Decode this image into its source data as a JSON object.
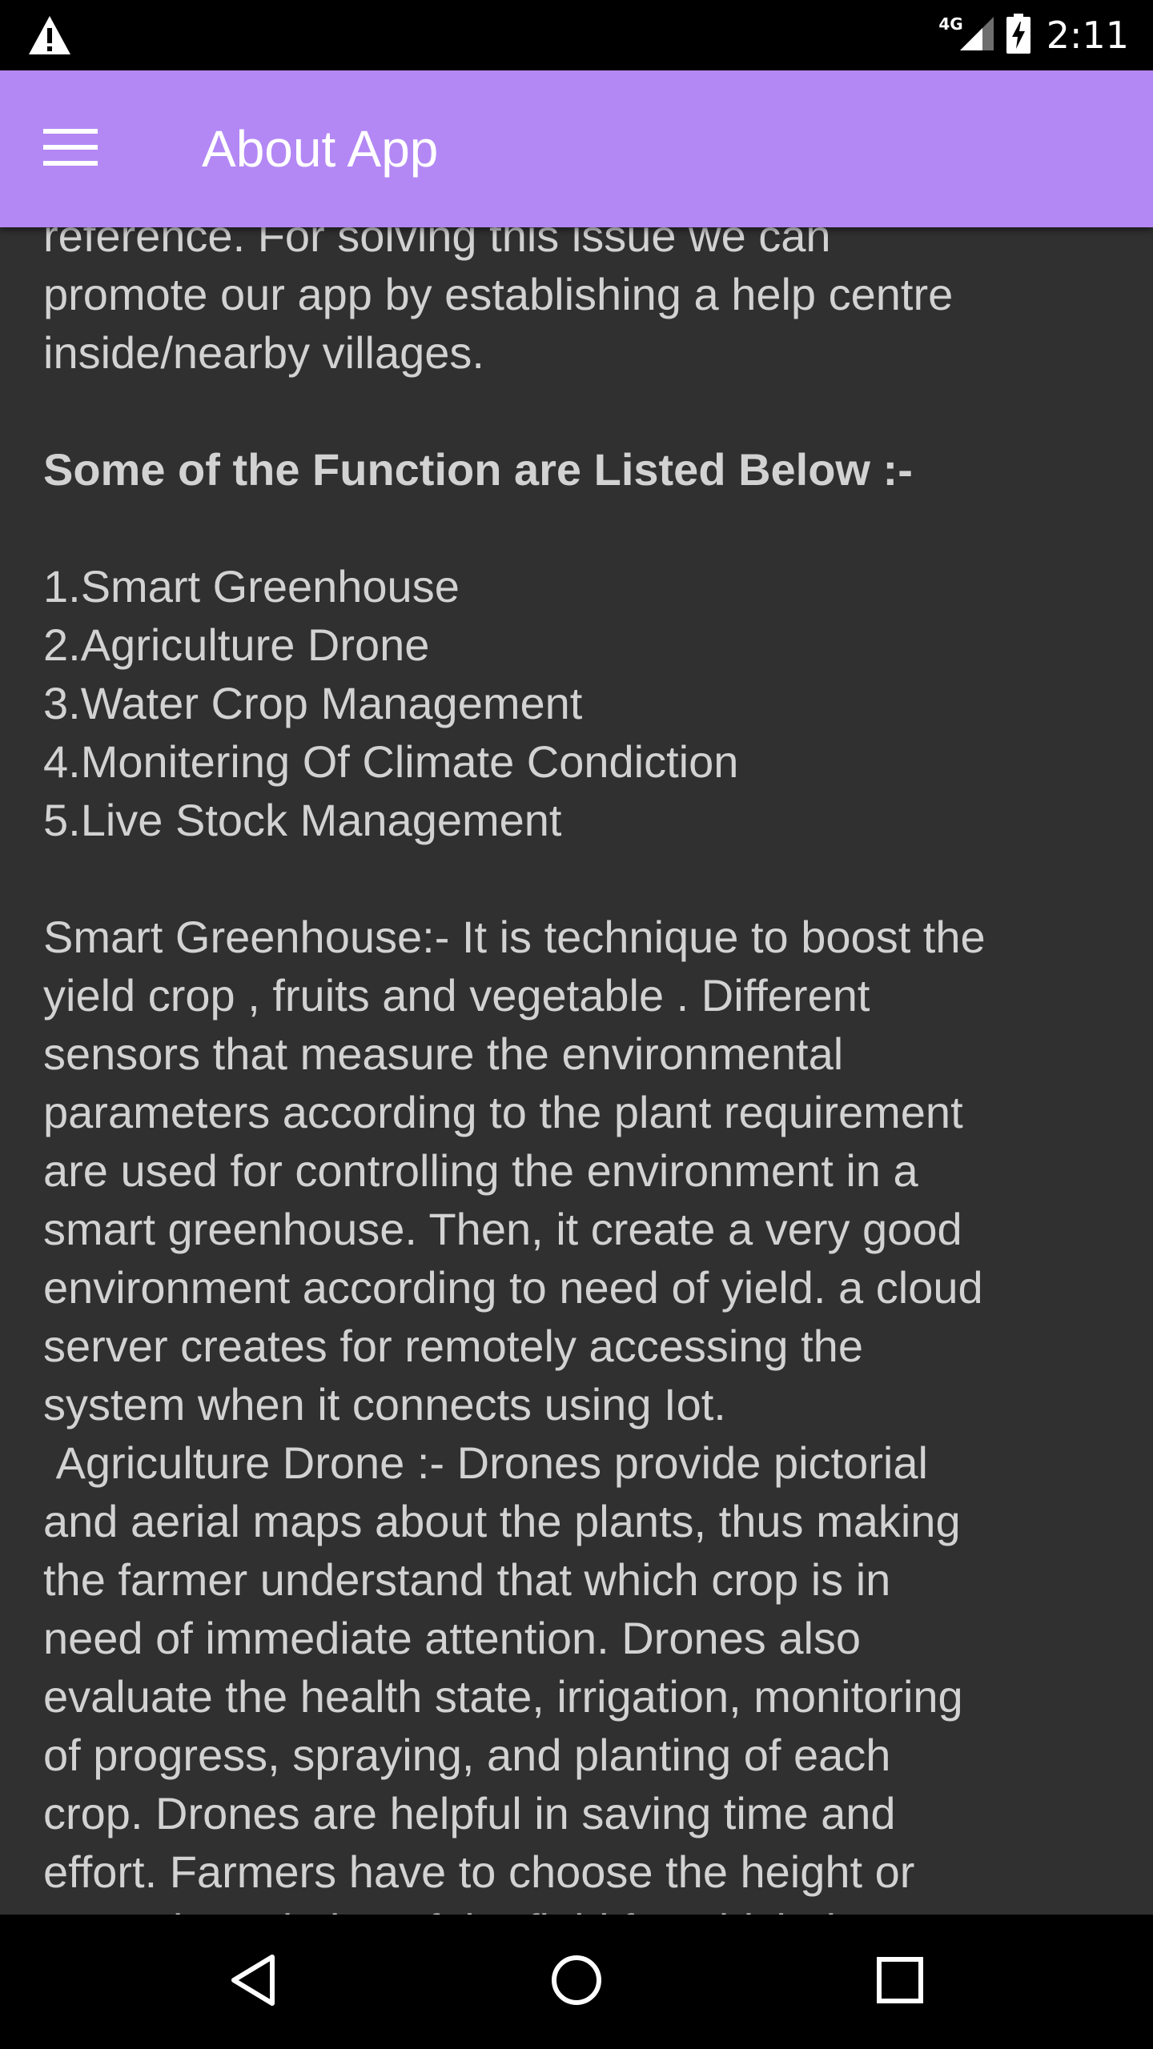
{
  "status_bar": {
    "network": "4G",
    "time": "2:11",
    "icons": [
      "warning-icon",
      "signal-icon",
      "battery-charging-icon"
    ]
  },
  "app_bar": {
    "title": "About App",
    "menu_icon": "hamburger-menu-icon",
    "color": "#b388f5"
  },
  "content": {
    "intro_lines": [
      "reference. For solving this issue we can",
      "promote our app by establishing a help centre",
      "inside/nearby villages."
    ],
    "functions_heading": "Some of the Function are Listed Below :-",
    "functions": [
      "1.Smart Greenhouse",
      "2.Agriculture Drone",
      "3.Water Crop Management",
      "4.Monitering Of Climate Condiction",
      "5.Live Stock Management"
    ],
    "greenhouse_lines": [
      "Smart Greenhouse:- It is technique to boost the",
      "yield crop , fruits and vegetable . Different",
      "sensors that measure the environmental",
      "parameters according to the plant requirement",
      "are used for controlling the environment in a",
      "smart greenhouse. Then, it create a very good",
      "environment according to need of yield. a cloud",
      "server creates for remotely accessing the",
      "system when it connects using Iot."
    ],
    "drone_lines": [
      " Agriculture Drone :- Drones provide pictorial",
      "and aerial maps about the plants, thus making",
      "the farmer understand that which crop is in",
      "need of immediate attention. Drones also",
      "evaluate the health state, irrigation, monitoring",
      "of progress, spraying, and planting of each",
      "crop. Drones are helpful in saving time and",
      "effort. Farmers have to choose the height or",
      "ground resolution of the field for which the"
    ]
  },
  "nav_bar": {
    "buttons": [
      "back-icon",
      "home-icon",
      "recents-icon"
    ]
  }
}
